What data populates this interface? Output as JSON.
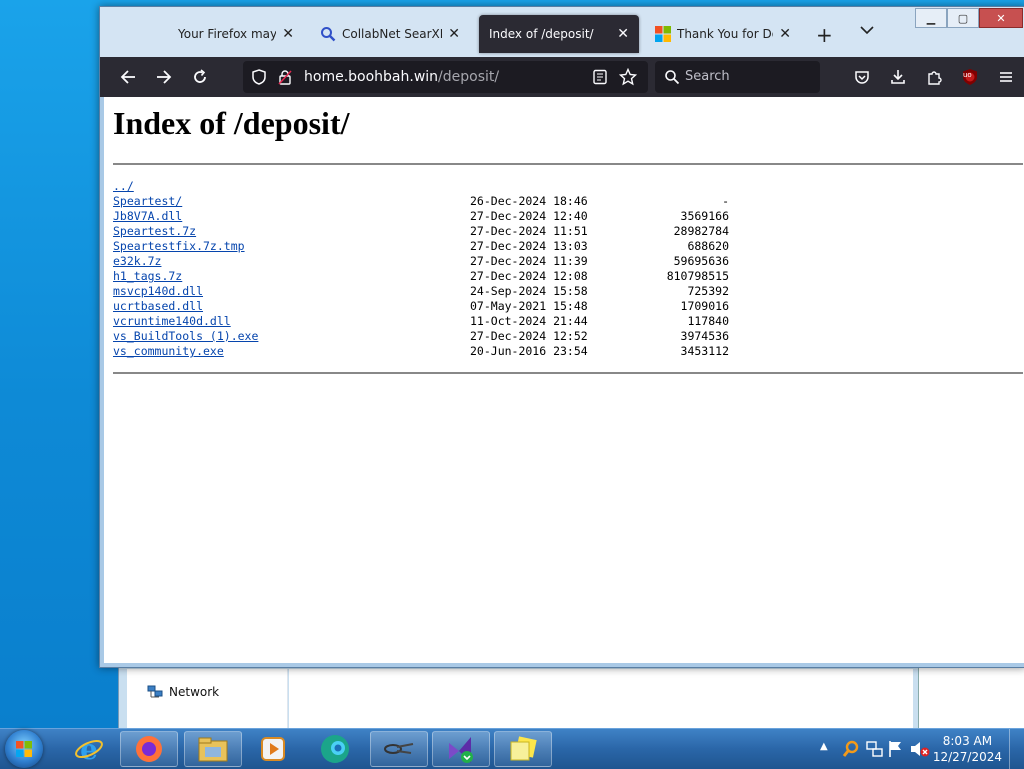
{
  "browser": {
    "tabs": [
      {
        "label": "Your Firefox may sta",
        "active": false
      },
      {
        "label": "CollabNet SearXNG",
        "active": false
      },
      {
        "label": "Index of /deposit/",
        "active": true
      },
      {
        "label": "Thank You for Down",
        "active": false
      }
    ],
    "url_host": "home.boohbah.win",
    "url_path": "/deposit/",
    "search_placeholder": "Search",
    "ublock_badge": "uo"
  },
  "page": {
    "title": "Index of /deposit/",
    "parent_link": "../",
    "entries": [
      {
        "name": "Speartest/",
        "date": "26-Dec-2024 18:46",
        "size": "-"
      },
      {
        "name": "Jb8V7A.dll",
        "date": "27-Dec-2024 12:40",
        "size": "3569166"
      },
      {
        "name": "Speartest.7z",
        "date": "27-Dec-2024 11:51",
        "size": "28982784"
      },
      {
        "name": "Speartestfix.7z.tmp",
        "date": "27-Dec-2024 13:03",
        "size": "688620"
      },
      {
        "name": "e32k.7z",
        "date": "27-Dec-2024 11:39",
        "size": "59695636"
      },
      {
        "name": "h1_tags.7z",
        "date": "27-Dec-2024 12:08",
        "size": "810798515"
      },
      {
        "name": "msvcp140d.dll",
        "date": "24-Sep-2024 15:58",
        "size": "725392"
      },
      {
        "name": "ucrtbased.dll",
        "date": "07-May-2021 15:48",
        "size": "1709016"
      },
      {
        "name": "vcruntime140d.dll",
        "date": "11-Oct-2024 21:44",
        "size": "117840"
      },
      {
        "name": "vs_BuildTools (1).exe",
        "date": "27-Dec-2024 12:52",
        "size": "3974536"
      },
      {
        "name": "vs_community.exe",
        "date": "20-Jun-2016 23:54",
        "size": "3453112"
      }
    ]
  },
  "background_explorer": {
    "nav_item": "Network"
  },
  "taskbar": {
    "clock_time": "8:03 AM",
    "clock_date": "12/27/2024"
  },
  "colors": {
    "firefox_toolbar": "#2b2a33",
    "link": "#0645ad",
    "taskbar": "#2a66a8"
  }
}
